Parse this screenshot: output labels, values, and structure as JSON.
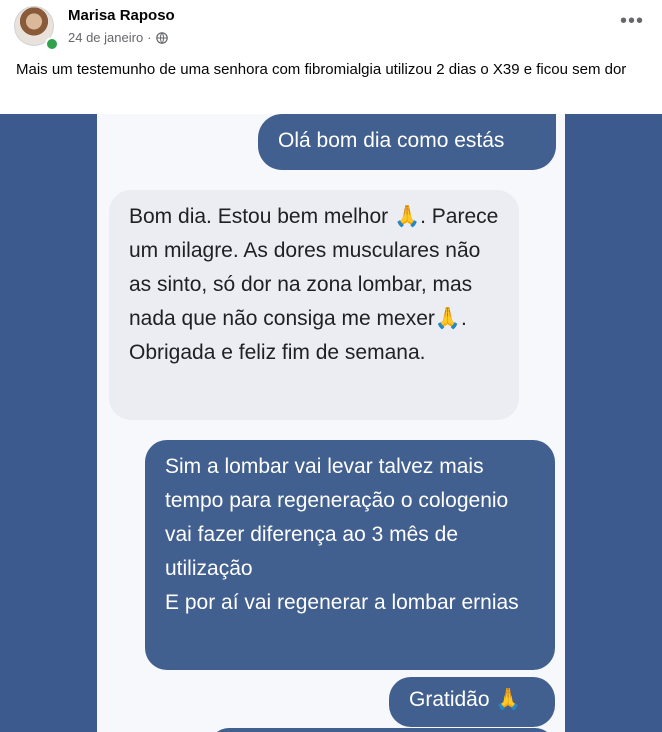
{
  "post": {
    "author": "Marisa Raposo",
    "date": "24 de janeiro",
    "date_sep": "·",
    "more_label": "•••",
    "caption": "Mais um testemunho de uma senhora com fibromialgia utilizou 2 dias o X39 e ficou sem dor"
  },
  "chat": {
    "messages": [
      {
        "side": "outgoing",
        "text": "Olá bom dia como estás"
      },
      {
        "side": "incoming",
        "text": "Bom dia. Estou bem melhor 🙏. Parece um milagre. As dores musculares não as sinto, só dor na zona lombar, mas nada que não consiga me mexer🙏. Obrigada e feliz fim de semana."
      },
      {
        "side": "outgoing",
        "text": "Sim a lombar vai levar talvez mais tempo para regeneração o cologenio vai fazer diferença ao 3 mês de utilização\nE por aí vai regenerar a lombar ernias"
      },
      {
        "side": "outgoing",
        "text": "Gratidão 🙏"
      }
    ]
  },
  "colors": {
    "outgoing_bubble": "#42608f",
    "incoming_bubble": "#ebedf2",
    "media_background": "#3d5a8f",
    "online_status": "#31a24c"
  },
  "icons": [
    "avatar",
    "online-status-icon",
    "globe-icon",
    "more-options-icon"
  ]
}
